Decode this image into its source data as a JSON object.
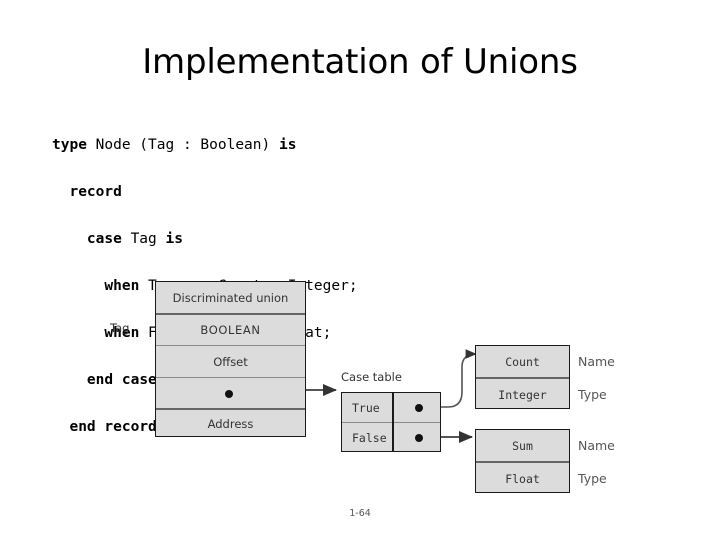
{
  "slide": {
    "title": "Implementation of Unions",
    "footer": "1-64"
  },
  "code": {
    "lines": [
      "type Node (Tag : Boolean) is",
      "  record",
      "    case Tag is",
      "      when True => Count : Integer;",
      "      when False => Sum : Float;",
      "    end case;",
      "  end record;"
    ],
    "line1": "type Node (Tag : Boolean) is",
    "line2": "  record",
    "line3": "    case Tag is",
    "line4": "      when True => Count : Integer;",
    "line5": "      when False => Sum : Float;",
    "line6": "    end case;",
    "line7": "  end record;"
  },
  "diagram": {
    "tag_label": "Tag",
    "case_table_label": "Case table",
    "descriptor": {
      "rows": [
        "Discriminated union",
        "BOOLEAN",
        "Offset",
        "",
        "Address"
      ]
    },
    "case_table": {
      "rows": [
        {
          "key": "True",
          "value": ""
        },
        {
          "key": "False",
          "value": ""
        }
      ]
    },
    "variant_true": {
      "name": "Count",
      "type": "Integer",
      "name_label": "Name",
      "type_label": "Type"
    },
    "variant_false": {
      "name": "Sum",
      "type": "Float",
      "name_label": "Name",
      "type_label": "Type"
    }
  },
  "colors": {
    "cell_fill": "#dcdcdc",
    "border": "#1a1a1a",
    "divider": "#8a8a8a",
    "text": "#333333",
    "connector": "#555555"
  }
}
